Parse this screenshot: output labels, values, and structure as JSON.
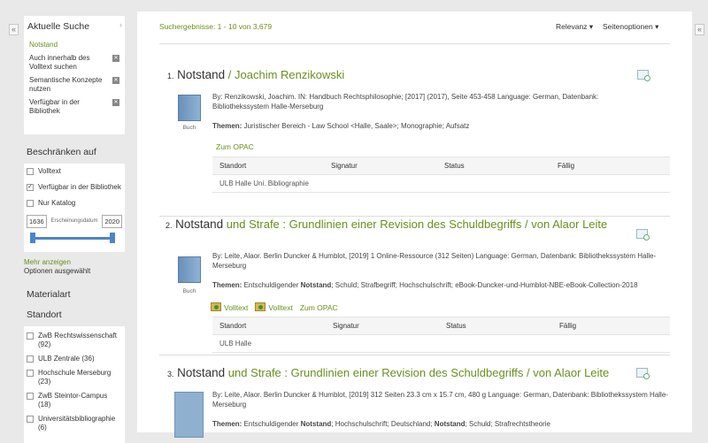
{
  "sidebar": {
    "current_search": {
      "title": "Aktuelle Suche",
      "query": "Notstand",
      "filters": [
        {
          "label": "Auch innerhalb des Volltext suchen"
        },
        {
          "label": "Semantische Konzepte nutzen"
        },
        {
          "label": "Verfügbar in der Bibliothek"
        }
      ]
    },
    "limit": {
      "title": "Beschränken auf",
      "options": [
        {
          "label": "Volltext",
          "checked": false
        },
        {
          "label": "Verfügbar in der Bibliothek",
          "checked": true
        },
        {
          "label": "Nur Katalog",
          "checked": false
        }
      ],
      "date_from": "1636",
      "date_to": "2020",
      "date_label": "Erscheinungsdatum",
      "more": "Mehr anzeigen",
      "optional": "Optionen ausgewählt"
    },
    "material": {
      "title": "Materialart"
    },
    "location": {
      "title": "Standort",
      "items": [
        {
          "label": "ZwB Rechtswissenschaft",
          "count": "(92)"
        },
        {
          "label": "ULB Zentrale",
          "count": "(36)"
        },
        {
          "label": "Hochschule Merseburg",
          "count": "(23)"
        },
        {
          "label": "ZwB Steintor-Campus",
          "count": "(18)"
        },
        {
          "label": "Universitätsbibliographie",
          "count": "(6)"
        }
      ]
    }
  },
  "header": {
    "results": "Suchergebnisse: 1 - 10 von 3,679",
    "sort": "Relevanz",
    "page_options": "Seitenoptionen"
  },
  "table_headers": [
    "Standort",
    "Signatur",
    "Status",
    "Fällig"
  ],
  "records": [
    {
      "num": "1.",
      "kw": "Notstand",
      "rest": " / Joachim Renzikowski",
      "meta": "By: Renzikowski, Joachim. IN: Handbuch Rechtsphilosophie; [2017] (2017), Seite 453-458 Language: German, Datenbank: Bibliothekssystem Halle-Merseburg",
      "themen_label": "Themen:",
      "themen": "Juristischer Bereich - Law School <Halle, Saale>; Monographie; Aufsatz",
      "cover_label": "Buch",
      "opac": "Zum OPAC",
      "holding": "ULB Halle Uni. Bibliographie"
    },
    {
      "num": "2.",
      "kw": "Notstand",
      "rest": " und Strafe : Grundlinien einer Revision des Schuldbegriffs / von Alaor Leite",
      "meta": "By: Leite, Alaor. Berlin Duncker & Humblot, [2019] 1 Online-Ressource (312 Seiten) Language: German, Datenbank: Bibliothekssystem Halle-Merseburg",
      "themen_label": "Themen:",
      "themen_pre": "Entschuldigender ",
      "themen_kw": "Notstand",
      "themen_post": "; Schuld; Strafbegriff; Hochschulschrift; eBook-Duncker-und-Humblot-NBE-eBook-Collection-2018",
      "cover_label": "Buch",
      "volltext1": "Volltext",
      "volltext2": "Volltext",
      "opac": "Zum OPAC",
      "holding": "ULB Halle"
    },
    {
      "num": "3.",
      "kw": "Notstand",
      "rest": " und Strafe : Grundlinien einer Revision des Schuldbegriffs / von Alaor Leite",
      "meta": "By: Leite, Alaor. Berlin Duncker & Humblot, [2019] 312 Seiten 23.3 cm x 15.7 cm, 480 g Language: German, Datenbank: Bibliothekssystem Halle-Merseburg",
      "themen_label": "Themen:",
      "themen_pre": "Entschuldigender ",
      "themen_kw": "Notstand",
      "themen_mid": "; Hochschulschrift; Deutschland; ",
      "themen_kw2": "Notstand",
      "themen_post": "; Schuld; Strafrechtstheorie"
    }
  ]
}
